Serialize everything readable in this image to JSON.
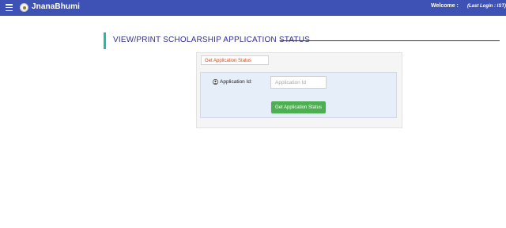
{
  "header": {
    "brand": "JnanaBhumi",
    "welcome_label": "Welcome :",
    "last_login": "(Last Login : IST)",
    "menu_icon": "hamburger-menu-icon",
    "logo_icon": "emblem-logo",
    "background_color": "#3e51b4"
  },
  "page": {
    "title": "VIEW/PRINT SCHOLARSHIP APPLICATION STATUS",
    "accent_color": "#1fbba6",
    "title_color": "#2f2f8f"
  },
  "form": {
    "tab_label": "Get Application Status",
    "field_label": "Application Id:",
    "field_icon": "user-circle-icon",
    "input_value": "",
    "input_placeholder": "Application Id",
    "submit_label": "Get Application Status",
    "submit_color": "#4caf50"
  }
}
